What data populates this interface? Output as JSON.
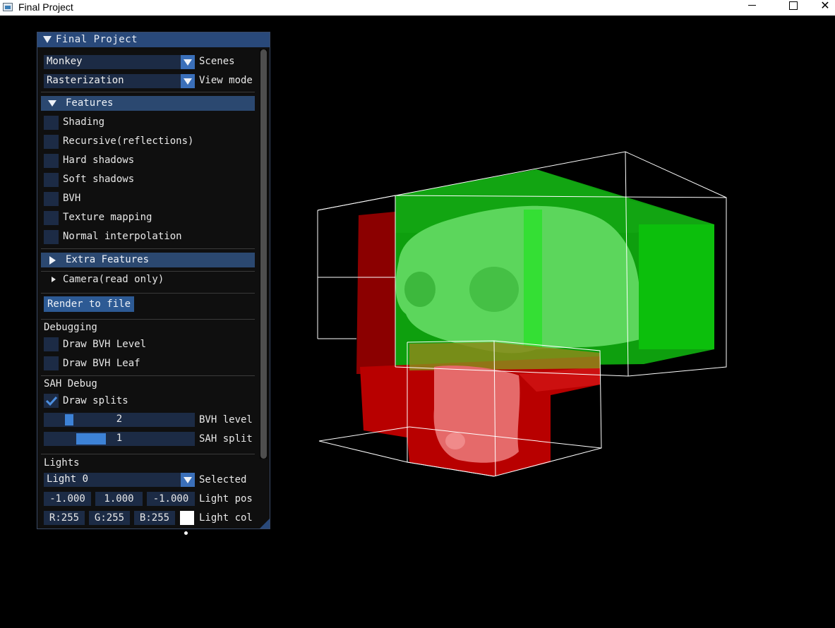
{
  "window": {
    "title": "Final Project",
    "minimize_icon": "minimize-icon",
    "maximize_icon": "maximize-icon",
    "close_icon": "close-icon",
    "close_glyph": "✕"
  },
  "panel": {
    "title": "Final Project",
    "scenes": {
      "value": "Monkey",
      "label": "Scenes"
    },
    "view_mode": {
      "value": "Rasterization",
      "label": "View mode"
    },
    "features": {
      "header": "Features",
      "items": [
        {
          "label": "Shading",
          "checked": false
        },
        {
          "label": "Recursive(reflections)",
          "checked": false
        },
        {
          "label": "Hard shadows",
          "checked": false
        },
        {
          "label": "Soft shadows",
          "checked": false
        },
        {
          "label": "BVH",
          "checked": false
        },
        {
          "label": "Texture mapping",
          "checked": false
        },
        {
          "label": "Normal interpolation",
          "checked": false
        }
      ]
    },
    "extra_features": {
      "header": "Extra Features"
    },
    "camera": {
      "label": "Camera(read only)"
    },
    "render_button": "Render to file",
    "debugging": {
      "header": "Debugging",
      "items": [
        {
          "label": "Draw BVH Level",
          "checked": false
        },
        {
          "label": "Draw BVH Leaf",
          "checked": false
        }
      ]
    },
    "sah_debug": {
      "header": "SAH Debug",
      "draw_splits": {
        "label": "Draw splits",
        "checked": true
      },
      "bvh_level": {
        "value": "2",
        "label": "BVH level",
        "fraction": 0.02
      },
      "sah_split": {
        "value": "1",
        "label": "SAH split",
        "fraction": 0.25
      }
    },
    "lights": {
      "header": "Lights",
      "selected": {
        "value": "Light 0",
        "label": "Selected"
      },
      "position": {
        "x": "-1.000",
        "y": "1.000",
        "z": "-1.000",
        "label": "Light pos"
      },
      "color": {
        "r": "R:255",
        "g": "G:255",
        "b": "B:255",
        "label": "Light col",
        "swatch": "#ffffff"
      }
    }
  },
  "scene": {
    "background": "#000000",
    "colors": {
      "green_box": "#11b511",
      "red_box": "#b00000",
      "monkey_green": "#5ed85e",
      "monkey_red": "#e86b6b",
      "wire": "#ffffff"
    }
  }
}
